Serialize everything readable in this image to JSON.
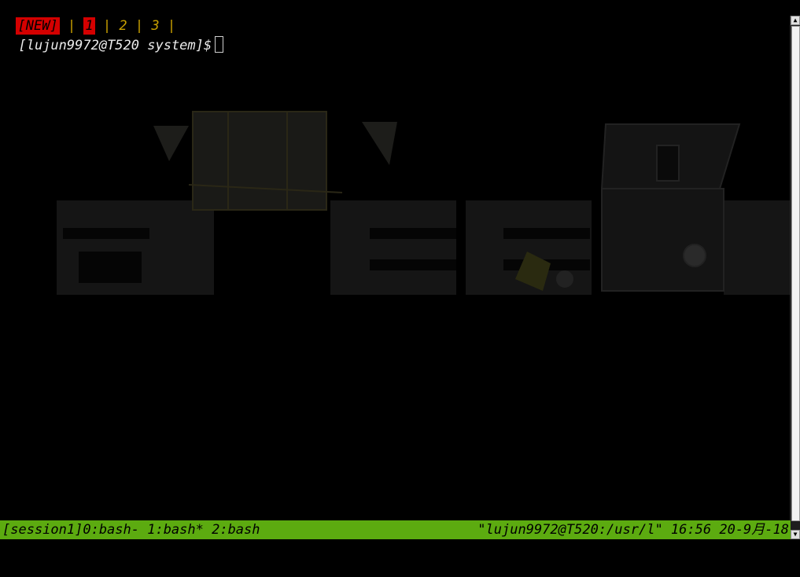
{
  "tabbar": {
    "tabs": [
      {
        "label": "[NEW]",
        "state": "new"
      },
      {
        "label": "1",
        "state": "active"
      },
      {
        "label": "2",
        "state": "normal"
      },
      {
        "label": "3",
        "state": "normal"
      }
    ],
    "separator": " | "
  },
  "terminal": {
    "prompt": "[lujun9972@T520 system]$"
  },
  "statusbar": {
    "left": "[session1]0:bash- 1:bash* 2:bash",
    "right": "\"lujun9972@T520:/usr/l\" 16:56 20-9月-18"
  },
  "colors": {
    "tab_active_bg": "#d40000",
    "tab_text": "#c8a000",
    "status_bg": "#5cab10"
  }
}
